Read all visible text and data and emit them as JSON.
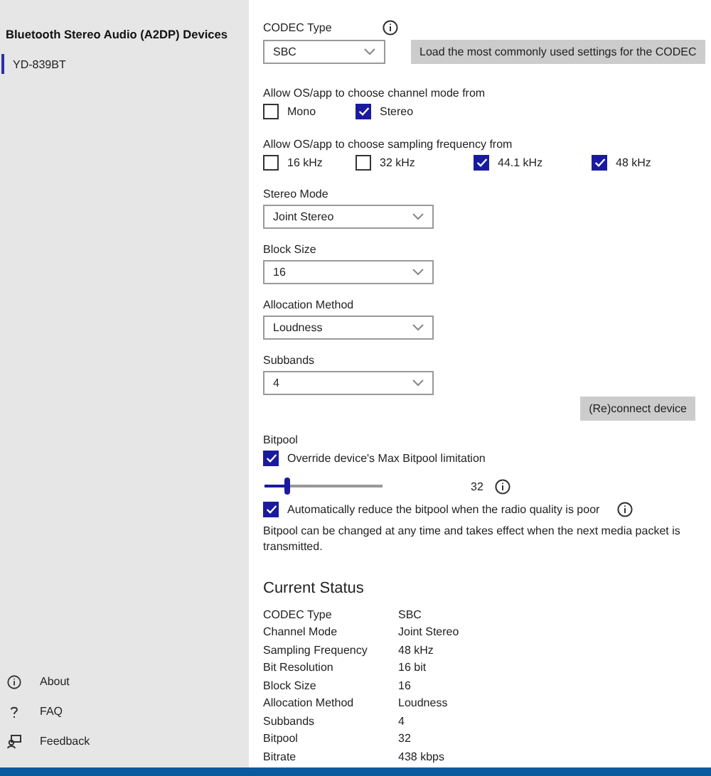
{
  "sidebar": {
    "heading": "Bluetooth Stereo Audio (A2DP) Devices",
    "devices": [
      {
        "label": "YD-839BT",
        "selected": true
      }
    ],
    "footer": [
      {
        "kind": "info",
        "label": "About"
      },
      {
        "kind": "question",
        "label": "FAQ"
      },
      {
        "kind": "feedback",
        "label": "Feedback"
      }
    ]
  },
  "codec": {
    "label": "CODEC Type",
    "value": "SBC",
    "load_button": "Load the most commonly used settings for the CODEC"
  },
  "channel_modes": {
    "label": "Allow OS/app to choose channel mode from",
    "options": [
      {
        "label": "Mono",
        "checked": false
      },
      {
        "label": "Stereo",
        "checked": true
      }
    ]
  },
  "sampling": {
    "label": "Allow OS/app to choose sampling frequency from",
    "options": [
      {
        "label": "16 kHz",
        "checked": false
      },
      {
        "label": "32 kHz",
        "checked": false
      },
      {
        "label": "44.1 kHz",
        "checked": true
      },
      {
        "label": "48 kHz",
        "checked": true
      }
    ]
  },
  "selects": [
    {
      "label": "Stereo Mode",
      "value": "Joint Stereo"
    },
    {
      "label": "Block Size",
      "value": "16"
    },
    {
      "label": "Allocation Method",
      "value": "Loudness"
    },
    {
      "label": "Subbands",
      "value": "4"
    }
  ],
  "reconnect_button": "(Re)connect device",
  "bitpool": {
    "label": "Bitpool",
    "override": {
      "label": "Override device's Max Bitpool limitation",
      "checked": true
    },
    "slider": {
      "level": 0.18,
      "reading": "32"
    },
    "auto_reduce": {
      "label": "Automatically reduce the bitpool when the radio quality is poor",
      "checked": true
    },
    "note": "Bitpool can be changed at any time and takes effect when the next media packet is transmitted."
  },
  "current_status": {
    "title": "Current Status",
    "rows": [
      {
        "name": "CODEC Type",
        "value": "SBC"
      },
      {
        "name": "Channel Mode",
        "value": "Joint Stereo"
      },
      {
        "name": "Sampling Frequency",
        "value": "48 kHz"
      },
      {
        "name": "Bit Resolution",
        "value": "16 bit"
      },
      {
        "name": "Block Size",
        "value": "16"
      },
      {
        "name": "Allocation Method",
        "value": "Loudness"
      },
      {
        "name": "Subbands",
        "value": "4"
      },
      {
        "name": "Bitpool",
        "value": "32"
      },
      {
        "name": "Bitrate",
        "value": "438 kbps"
      }
    ]
  }
}
